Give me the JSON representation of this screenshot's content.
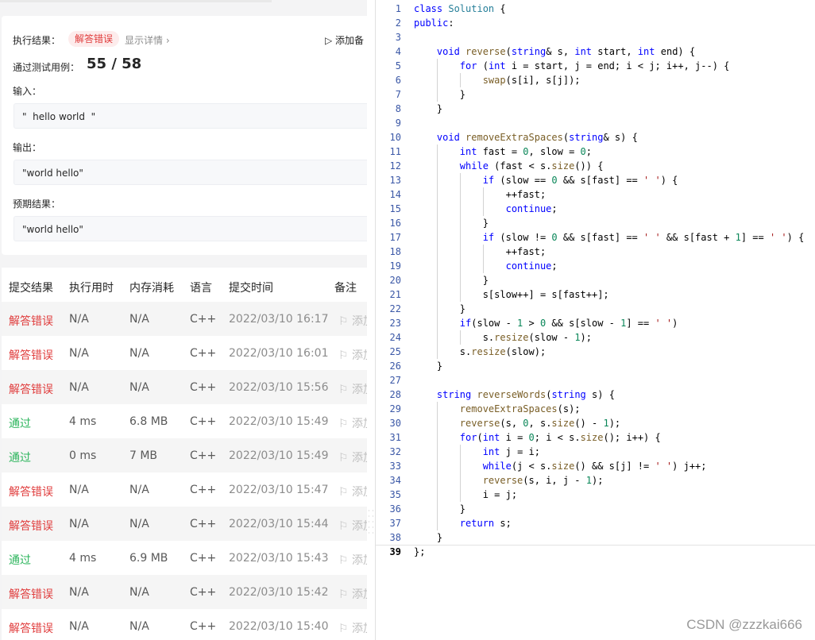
{
  "result": {
    "exec_label": "执行结果：",
    "status": "解答错误",
    "detail_link": "显示详情 ›",
    "add_note": "▷ 添加备",
    "pass_label": "通过测试用例：",
    "pass_count": "55 / 58",
    "input_label": "输入：",
    "input_value": "\"  hello world  \"",
    "output_label": "输出：",
    "output_value": "\"world hello\"",
    "expected_label": "预期结果：",
    "expected_value": "\"world hello\""
  },
  "submissions": {
    "headers": [
      "提交结果",
      "执行用时",
      "内存消耗",
      "语言",
      "提交时间",
      "备注"
    ],
    "rows": [
      {
        "result": "解答错误",
        "status": "error",
        "runtime": "N/A",
        "memory": "N/A",
        "lang": "C++",
        "time": "2022/03/10 16:17",
        "note": "添加"
      },
      {
        "result": "解答错误",
        "status": "error",
        "runtime": "N/A",
        "memory": "N/A",
        "lang": "C++",
        "time": "2022/03/10 16:01",
        "note": "添加"
      },
      {
        "result": "解答错误",
        "status": "error",
        "runtime": "N/A",
        "memory": "N/A",
        "lang": "C++",
        "time": "2022/03/10 15:56",
        "note": "添加"
      },
      {
        "result": "通过",
        "status": "ok",
        "runtime": "4 ms",
        "memory": "6.8 MB",
        "lang": "C++",
        "time": "2022/03/10 15:49",
        "note": "添加"
      },
      {
        "result": "通过",
        "status": "ok",
        "runtime": "0 ms",
        "memory": "7 MB",
        "lang": "C++",
        "time": "2022/03/10 15:49",
        "note": "添加"
      },
      {
        "result": "解答错误",
        "status": "error",
        "runtime": "N/A",
        "memory": "N/A",
        "lang": "C++",
        "time": "2022/03/10 15:47",
        "note": "添加"
      },
      {
        "result": "解答错误",
        "status": "error",
        "runtime": "N/A",
        "memory": "N/A",
        "lang": "C++",
        "time": "2022/03/10 15:44",
        "note": "添加"
      },
      {
        "result": "通过",
        "status": "ok",
        "runtime": "4 ms",
        "memory": "6.9 MB",
        "lang": "C++",
        "time": "2022/03/10 15:43",
        "note": "添加"
      },
      {
        "result": "解答错误",
        "status": "error",
        "runtime": "N/A",
        "memory": "N/A",
        "lang": "C++",
        "time": "2022/03/10 15:42",
        "note": "添加"
      },
      {
        "result": "解答错误",
        "status": "error",
        "runtime": "N/A",
        "memory": "N/A",
        "lang": "C++",
        "time": "2022/03/10 15:40",
        "note": "添加"
      }
    ]
  },
  "editor": {
    "current_line": 39,
    "code_lines": [
      "class Solution {",
      "public:",
      "",
      "    void reverse(string& s, int start, int end) {",
      "        for (int i = start, j = end; i < j; i++, j--) {",
      "            swap(s[i], s[j]);",
      "        }",
      "    }",
      "",
      "    void removeExtraSpaces(string& s) {",
      "        int fast = 0, slow = 0;",
      "        while (fast < s.size()) {",
      "            if (slow == 0 && s[fast] == ' ') {",
      "                ++fast;",
      "                continue;",
      "            }",
      "            if (slow != 0 && s[fast] == ' ' && s[fast + 1] == ' ') {",
      "                ++fast;",
      "                continue;",
      "            }",
      "            s[slow++] = s[fast++];",
      "        }",
      "        if(slow - 1 > 0 && s[slow - 1] == ' ')",
      "            s.resize(slow - 1);",
      "        s.resize(slow);",
      "    }",
      "",
      "    string reverseWords(string s) {",
      "        removeExtraSpaces(s);",
      "        reverse(s, 0, s.size() - 1);",
      "        for(int i = 0; i < s.size(); i++) {",
      "            int j = i;",
      "            while(j < s.size() && s[j] != ' ') j++;",
      "            reverse(s, i, j - 1);",
      "            i = j;",
      "        }",
      "        return s;",
      "    }",
      "};"
    ]
  },
  "watermark": "CSDN @zzzkai666",
  "colors": {
    "error": "#e03c3c",
    "ok": "#2db55d",
    "keyword": "#0000ff",
    "type": "#267f99",
    "function": "#795e26",
    "number": "#098658",
    "string": "#a31515",
    "line_number": "#3a57a6"
  }
}
